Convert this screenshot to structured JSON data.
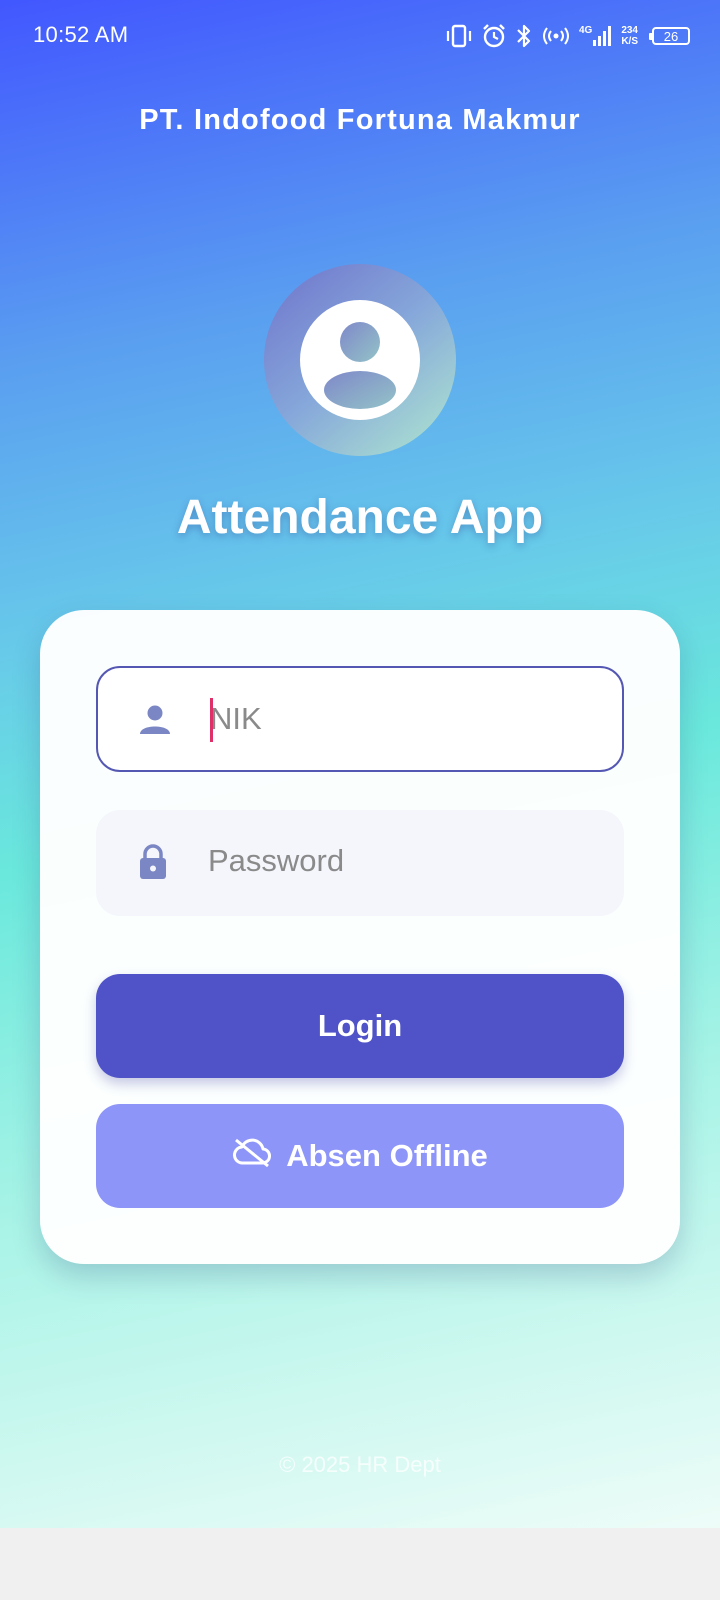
{
  "status_bar": {
    "time": "10:52 AM",
    "network_type": "4G",
    "net_speed_value": "234",
    "net_speed_unit": "K/S",
    "battery_level": "26"
  },
  "header": {
    "company_name": "PT. Indofood Fortuna Makmur",
    "app_title": "Attendance App"
  },
  "form": {
    "nik_placeholder": "NIK",
    "nik_value": "",
    "password_placeholder": "Password",
    "password_value": "",
    "login_label": "Login",
    "offline_label": "Absen Offline"
  },
  "footer": {
    "copyright": "© 2025 HR Dept"
  },
  "colors": {
    "primary": "#5053c8",
    "secondary": "#8e95f8",
    "icon": "#7b86c4",
    "cursor": "#e0306a"
  },
  "icons": {
    "nik": "person-icon",
    "password": "lock-icon",
    "offline": "cloud-off-icon",
    "avatar": "account-circle-icon"
  }
}
